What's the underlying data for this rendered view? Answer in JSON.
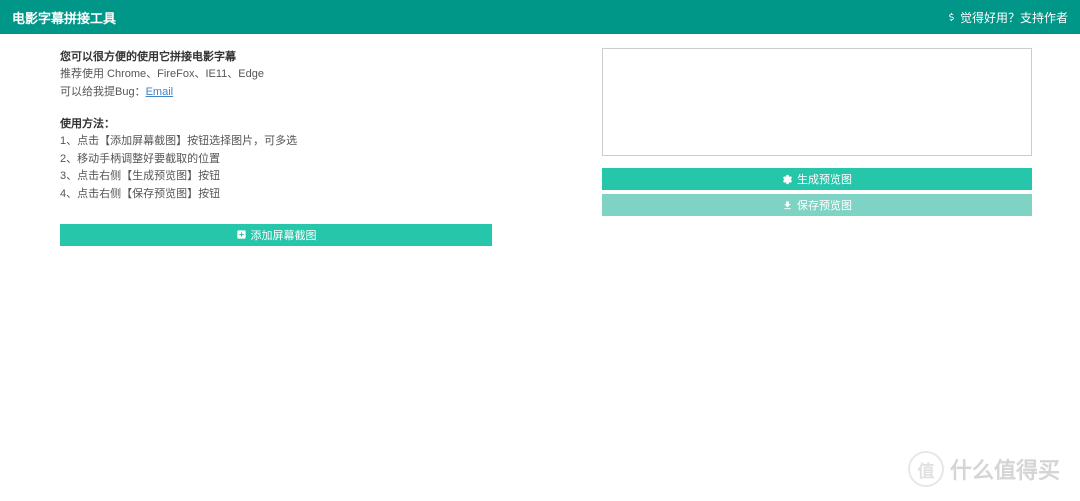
{
  "header": {
    "title": "电影字幕拼接工具",
    "support_link": "觉得好用？支持作者"
  },
  "intro": {
    "line1": "您可以很方便的使用它拼接电影字幕",
    "line2_prefix": "推荐使用 Chrome、FireFox、IE11、Edge",
    "line3_prefix": "可以给我提Bug：",
    "line3_link": "Email"
  },
  "usage": {
    "title": "使用方法：",
    "steps": [
      "1、点击【添加屏幕截图】按钮选择图片，可多选",
      "2、移动手柄调整好要截取的位置",
      "3、点击右侧【生成预览图】按钮",
      "4、点击右侧【保存预览图】按钮"
    ]
  },
  "buttons": {
    "add": "添加屏幕截图",
    "generate": "生成预览图",
    "save": "保存预览图"
  },
  "watermark": {
    "circle": "值",
    "text": "什么值得买"
  }
}
